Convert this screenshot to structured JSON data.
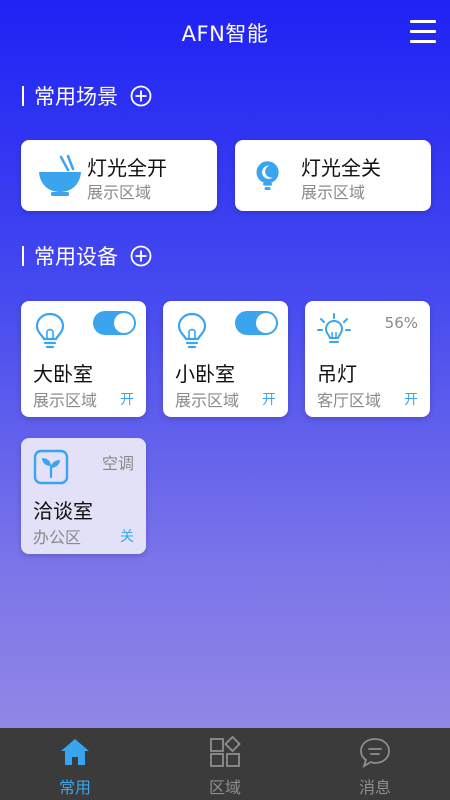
{
  "header": {
    "title": "AFN智能",
    "menu_icon": "menu-icon"
  },
  "sections": {
    "scenes_title": "常用场景",
    "devices_title": "常用设备"
  },
  "scenes": [
    {
      "name": "灯光全开",
      "area": "展示区域",
      "icon": "bowl-icon"
    },
    {
      "name": "灯光全关",
      "area": "展示区域",
      "icon": "bulb-moon-icon"
    }
  ],
  "devices": [
    {
      "name": "大卧室",
      "area": "展示区域",
      "state": "开",
      "toggle_on": true,
      "icon": "bulb-icon"
    },
    {
      "name": "小卧室",
      "area": "展示区域",
      "state": "开",
      "toggle_on": true,
      "icon": "bulb-icon"
    },
    {
      "name": "吊灯",
      "area": "客厅区域",
      "state": "开",
      "brightness": "56%",
      "icon": "bulb-bright-icon"
    },
    {
      "name": "洽谈室",
      "area": "办公区",
      "state": "关",
      "type_label": "空调",
      "icon": "leaf-icon"
    }
  ],
  "tabs": [
    {
      "label": "常用",
      "active": true,
      "icon": "home-icon"
    },
    {
      "label": "区域",
      "active": false,
      "icon": "grid-icon"
    },
    {
      "label": "消息",
      "active": false,
      "icon": "chat-icon"
    }
  ],
  "colors": {
    "accent": "#3aa5ee",
    "tabbar": "#3b3b3b",
    "gradient_top": "#1f22f4",
    "gradient_bottom": "#9b8ee3"
  }
}
